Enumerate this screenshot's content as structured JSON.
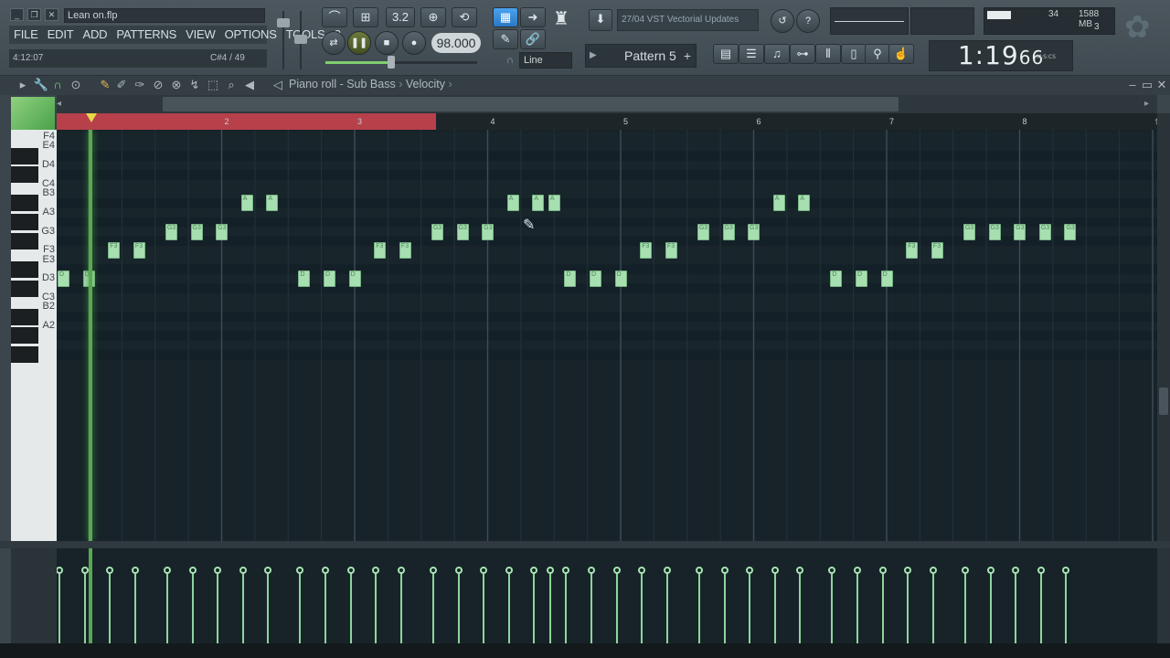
{
  "window": {
    "project_title": "Lean on.flp",
    "minimize": "_",
    "restore": "❐",
    "close": "✕"
  },
  "menu": [
    "FILE",
    "EDIT",
    "ADD",
    "PATTERNS",
    "VIEW",
    "OPTIONS",
    "TOOLS",
    "?"
  ],
  "hint": {
    "time": "4:12:07",
    "note": "C#4 / 49"
  },
  "transport": {
    "tempo": "98.000",
    "snap": "Line",
    "pattern": "Pattern 5",
    "pattern_add": "+"
  },
  "news": "27/04  VST Vectorial Updates",
  "cpu": {
    "value": "34",
    "memory": "1588 MB",
    "polyphony": "3"
  },
  "clock": {
    "time": "1:19",
    "frac": "66",
    "label": "M:S:CS"
  },
  "pianoroll": {
    "title": "Piano roll - Sub Bass",
    "target": "Velocity"
  },
  "bars": [
    "2",
    "3",
    "4",
    "5",
    "6",
    "7",
    "8",
    "9"
  ],
  "keys": [
    "F4",
    "E4",
    "D4",
    "C4",
    "B3",
    "A3",
    "G3",
    "F3",
    "E3",
    "D3",
    "C3",
    "B2",
    "A2"
  ],
  "notes": [
    {
      "label": "D",
      "pitch": "D3",
      "bar": 1.0
    },
    {
      "label": "D",
      "pitch": "D3",
      "bar": 1.19
    },
    {
      "label": "F3",
      "pitch": "F3",
      "bar": 1.38
    },
    {
      "label": "F3",
      "pitch": "F3",
      "bar": 1.57
    },
    {
      "label": "G3",
      "pitch": "G3",
      "bar": 1.81
    },
    {
      "label": "G3",
      "pitch": "G3",
      "bar": 2.0
    },
    {
      "label": "G3",
      "pitch": "G3",
      "bar": 2.19
    },
    {
      "label": "A",
      "pitch": "A#3",
      "bar": 2.38
    },
    {
      "label": "A",
      "pitch": "A#3",
      "bar": 2.57
    },
    {
      "label": "D",
      "pitch": "D3",
      "bar": 2.81
    },
    {
      "label": "D",
      "pitch": "D3",
      "bar": 3.0
    },
    {
      "label": "D",
      "pitch": "D3",
      "bar": 3.19
    },
    {
      "label": "F3",
      "pitch": "F3",
      "bar": 3.38
    },
    {
      "label": "F3",
      "pitch": "F3",
      "bar": 3.57
    },
    {
      "label": "G3",
      "pitch": "G3",
      "bar": 3.81
    },
    {
      "label": "G3",
      "pitch": "G3",
      "bar": 4.0
    },
    {
      "label": "G3",
      "pitch": "G3",
      "bar": 4.19
    },
    {
      "label": "A",
      "pitch": "A#3",
      "bar": 4.38
    },
    {
      "label": "A",
      "pitch": "A#3",
      "bar": 4.57
    },
    {
      "label": "A",
      "pitch": "A#3",
      "bar": 4.69
    },
    {
      "label": "D",
      "pitch": "D3",
      "bar": 4.81
    },
    {
      "label": "D",
      "pitch": "D3",
      "bar": 5.0
    },
    {
      "label": "D",
      "pitch": "D3",
      "bar": 5.19
    },
    {
      "label": "F3",
      "pitch": "F3",
      "bar": 5.38
    },
    {
      "label": "F3",
      "pitch": "F3",
      "bar": 5.57
    },
    {
      "label": "G3",
      "pitch": "G3",
      "bar": 5.81
    },
    {
      "label": "G3",
      "pitch": "G3",
      "bar": 6.0
    },
    {
      "label": "G3",
      "pitch": "G3",
      "bar": 6.19
    },
    {
      "label": "A",
      "pitch": "A#3",
      "bar": 6.38
    },
    {
      "label": "A",
      "pitch": "A#3",
      "bar": 6.57
    },
    {
      "label": "D",
      "pitch": "D3",
      "bar": 6.81
    },
    {
      "label": "D",
      "pitch": "D3",
      "bar": 7.0
    },
    {
      "label": "D",
      "pitch": "D3",
      "bar": 7.19
    },
    {
      "label": "F3",
      "pitch": "F3",
      "bar": 7.38
    },
    {
      "label": "F3",
      "pitch": "F3",
      "bar": 7.57
    },
    {
      "label": "G3",
      "pitch": "G3",
      "bar": 7.81
    },
    {
      "label": "G3",
      "pitch": "G3",
      "bar": 8.0
    },
    {
      "label": "G3",
      "pitch": "G3",
      "bar": 8.19
    },
    {
      "label": "G3",
      "pitch": "G3",
      "bar": 8.38
    },
    {
      "label": "G3",
      "pitch": "G3",
      "bar": 8.57
    }
  ]
}
